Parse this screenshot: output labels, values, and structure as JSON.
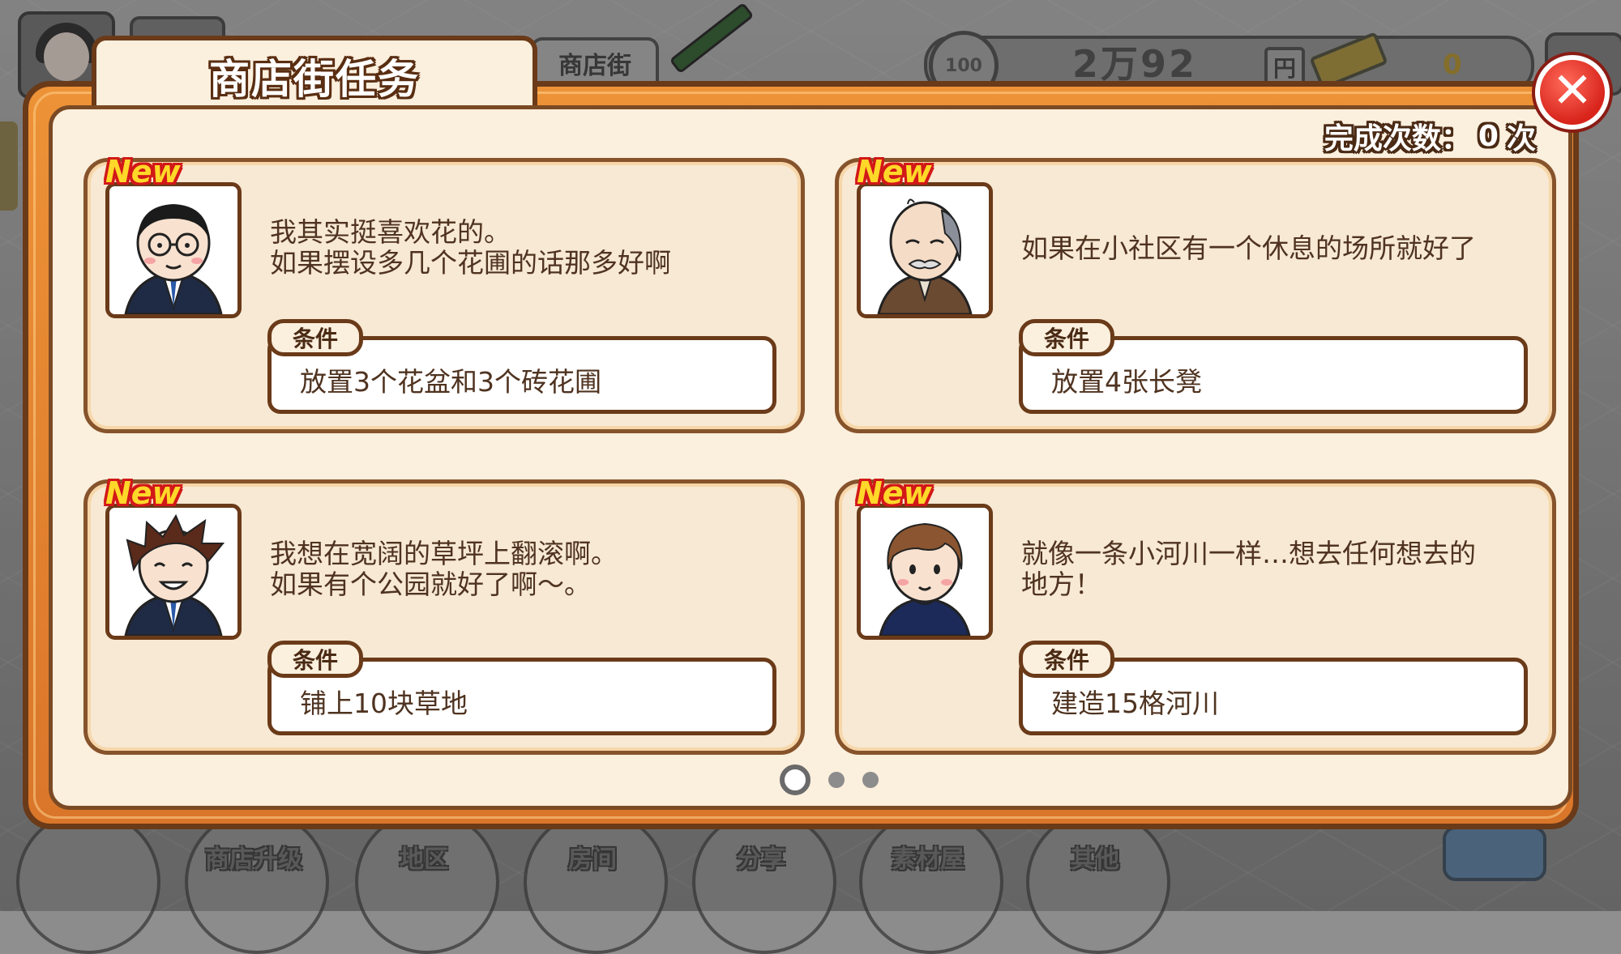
{
  "background_hud": {
    "top_tab_label": "商店街",
    "money_value": "2万92",
    "currency_unit": "円",
    "coin_label": "100",
    "gold_value": "0"
  },
  "bottom_menu": [
    {
      "label": ""
    },
    {
      "label": "商店升级"
    },
    {
      "label": "地区"
    },
    {
      "label": "房间"
    },
    {
      "label": "分享"
    },
    {
      "label": "素材屋"
    },
    {
      "label": "其他"
    }
  ],
  "dialog": {
    "title": "商店街任务",
    "completion_label": "完成次数：",
    "completion_count": "0",
    "completion_unit": "次",
    "close_symbol": "✕"
  },
  "quests": [
    {
      "badge": "New",
      "character": "glasses-businessman",
      "speech_line1": "我其实挺喜欢花的。",
      "speech_line2": "如果摆设多几个花圃的话那多好啊",
      "condition_label": "条件",
      "condition": "放置3个花盆和3个砖花圃"
    },
    {
      "badge": "New",
      "character": "old-man",
      "speech_line1": "如果在小社区有一个休息的场所就好了",
      "speech_line2": "",
      "condition_label": "条件",
      "condition": "放置4张长凳"
    },
    {
      "badge": "New",
      "character": "spiky-hair-businessman",
      "speech_line1": "我想在宽阔的草坪上翻滚啊。",
      "speech_line2": "如果有个公园就好了啊～。",
      "condition_label": "条件",
      "condition": "铺上10块草地"
    },
    {
      "badge": "New",
      "character": "brown-hair-boy",
      "speech_line1": "就像一条小河川一样…想去任何想去的",
      "speech_line2": "地方！",
      "condition_label": "条件",
      "condition": "建造15格河川"
    }
  ],
  "pagination": {
    "total": 3,
    "current": 1
  },
  "colors": {
    "frame_orange": "#ed9237",
    "frame_border": "#6a3a19",
    "panel_cream": "#fbefdd",
    "new_badge_yellow": "#ffd829",
    "new_badge_outline": "#d21818",
    "close_red": "#d8241b"
  }
}
